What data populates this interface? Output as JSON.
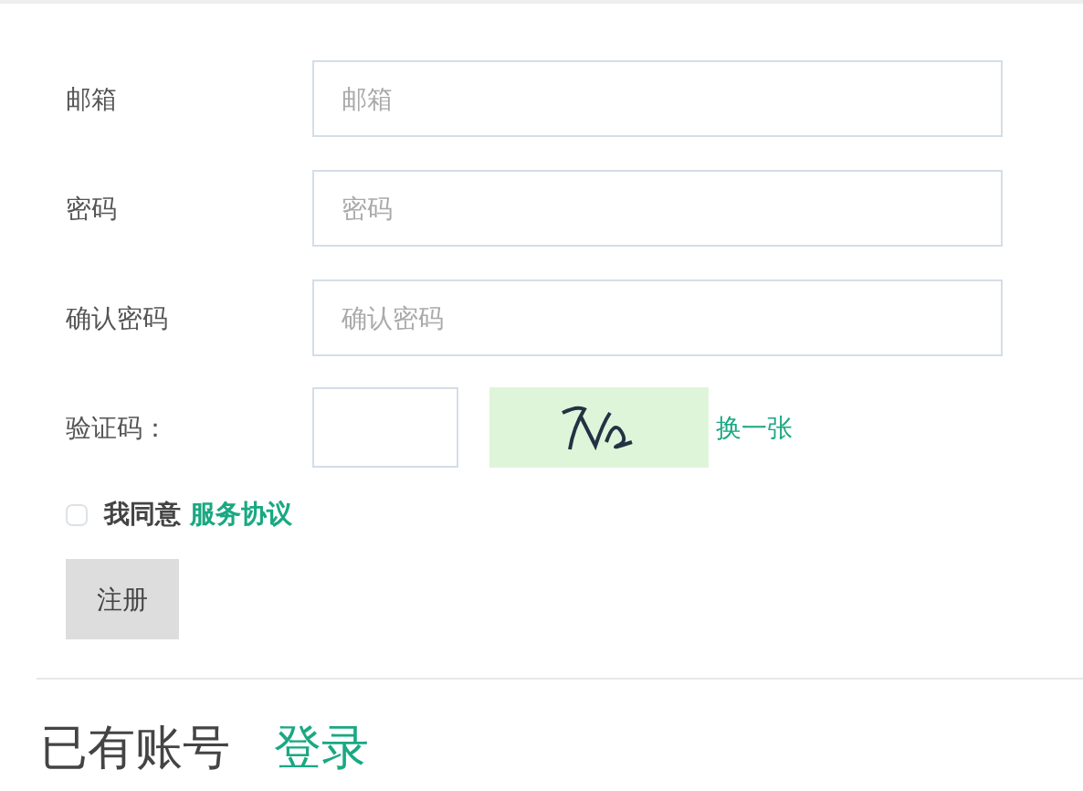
{
  "fields": [
    {
      "label": "邮箱",
      "placeholder": "邮箱"
    },
    {
      "label": "密码",
      "placeholder": "密码"
    },
    {
      "label": "确认密码",
      "placeholder": "确认密码"
    }
  ],
  "captcha": {
    "label": "验证码：",
    "refresh_link": "换一张"
  },
  "agreement": {
    "checked": false,
    "text": "我同意",
    "link": "服务协议"
  },
  "submit_button": "注册",
  "footer": {
    "text": "已有账号",
    "link": "登录"
  }
}
